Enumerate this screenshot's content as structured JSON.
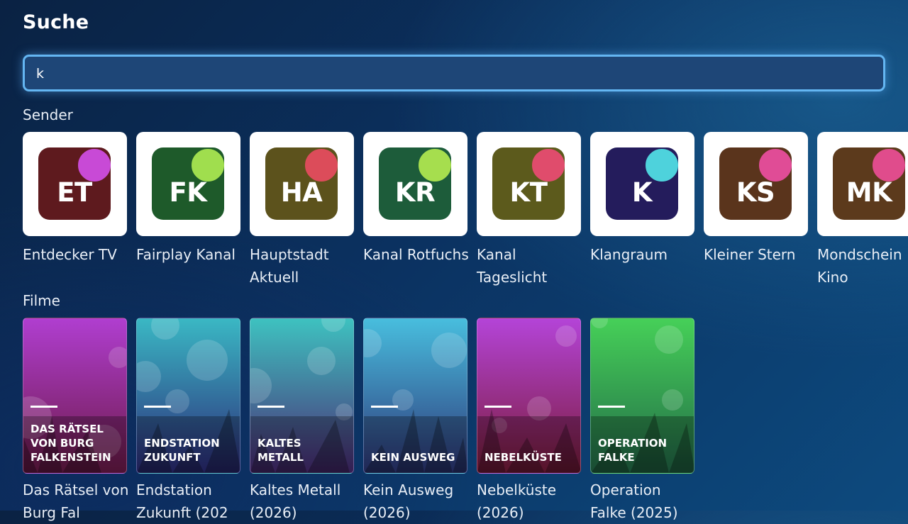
{
  "page": {
    "title": "Suche"
  },
  "search": {
    "value": "k"
  },
  "sections": {
    "channels": "Sender",
    "movies": "Filme"
  },
  "channels": [
    {
      "initials": "ET",
      "name": "Entdecker TV",
      "bg": "#5e1a1e",
      "dot": "#c84ad6"
    },
    {
      "initials": "FK",
      "name": "Fairplay Kanal",
      "bg": "#1e5a2a",
      "dot": "#a0de4e"
    },
    {
      "initials": "HA",
      "name": "Hauptstadt Aktuell",
      "bg": "#5c521c",
      "dot": "#dc4c5a"
    },
    {
      "initials": "KR",
      "name": "Kanal Rotfuchs",
      "bg": "#1d5c3a",
      "dot": "#a6de4e"
    },
    {
      "initials": "KT",
      "name": "Kanal Tageslicht",
      "bg": "#5c5a1c",
      "dot": "#e04c6c"
    },
    {
      "initials": "K",
      "name": "Klangraum",
      "bg": "#241c5c",
      "dot": "#4ed2dc"
    },
    {
      "initials": "KS",
      "name": "Kleiner Stern",
      "bg": "#5a341c",
      "dot": "#e04c96"
    },
    {
      "initials": "MK",
      "name": "Mondschein Kino",
      "bg": "#5c3a1c",
      "dot": "#e04c8c"
    }
  ],
  "movies": [
    {
      "poster_title": "Das Rätsel von Burg Falkenstein",
      "name": "Das Rätsel von Burg Fal",
      "top": "#b03ed0",
      "bottom": "#6c1a48"
    },
    {
      "poster_title": "Endstation Zukunft",
      "name": "Endstation Zukunft (202",
      "top": "#3ab8c4",
      "bottom": "#2c2a78"
    },
    {
      "poster_title": "Kaltes Metall",
      "name": "Kaltes Metall (2026)",
      "top": "#3ec2c0",
      "bottom": "#4a2a74"
    },
    {
      "poster_title": "Kein Ausweg",
      "name": "Kein Ausweg (2026)",
      "top": "#48bede",
      "bottom": "#2e3678"
    },
    {
      "poster_title": "Nebelküste",
      "name": "Nebelküste (2026)",
      "top": "#b444d8",
      "bottom": "#7a1c3a"
    },
    {
      "poster_title": "Operation Falke",
      "name": "Operation Falke (2025)",
      "top": "#46d058",
      "bottom": "#226a48"
    }
  ]
}
